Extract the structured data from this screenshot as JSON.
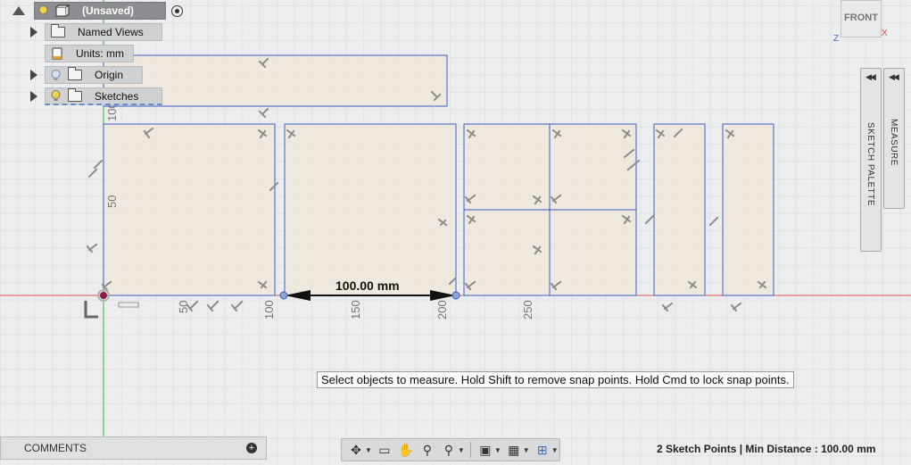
{
  "browser": {
    "root_label": "(Unsaved)",
    "items": [
      {
        "label": "Named Views"
      },
      {
        "label": "Units: mm"
      },
      {
        "label": "Origin"
      },
      {
        "label": "Sketches"
      }
    ]
  },
  "viewcube": {
    "face": "FRONT",
    "x_label": "X",
    "z_label": "Z"
  },
  "palettes": {
    "sketch_palette": "SKETCH PALETTE",
    "measure": "MEASURE"
  },
  "ruler": {
    "left_50": "50",
    "left_100": "100",
    "b_50": "50",
    "b_100": "100",
    "b_150": "150",
    "b_200": "200",
    "b_250": "250"
  },
  "dimension": {
    "label": "100.00 mm"
  },
  "tooltip": {
    "text": "Select objects to measure. Hold Shift to remove snap points. Hold Cmd to lock snap points."
  },
  "comments": {
    "label": "COMMENTS"
  },
  "status": {
    "text": "2 Sketch Points | Min Distance : 100.00 mm"
  },
  "colors": {
    "sketch_fill": "#efe7dc",
    "sketch_line": "#3a5ec6",
    "axis_red": "#e05050",
    "axis_green": "#44bb44"
  }
}
